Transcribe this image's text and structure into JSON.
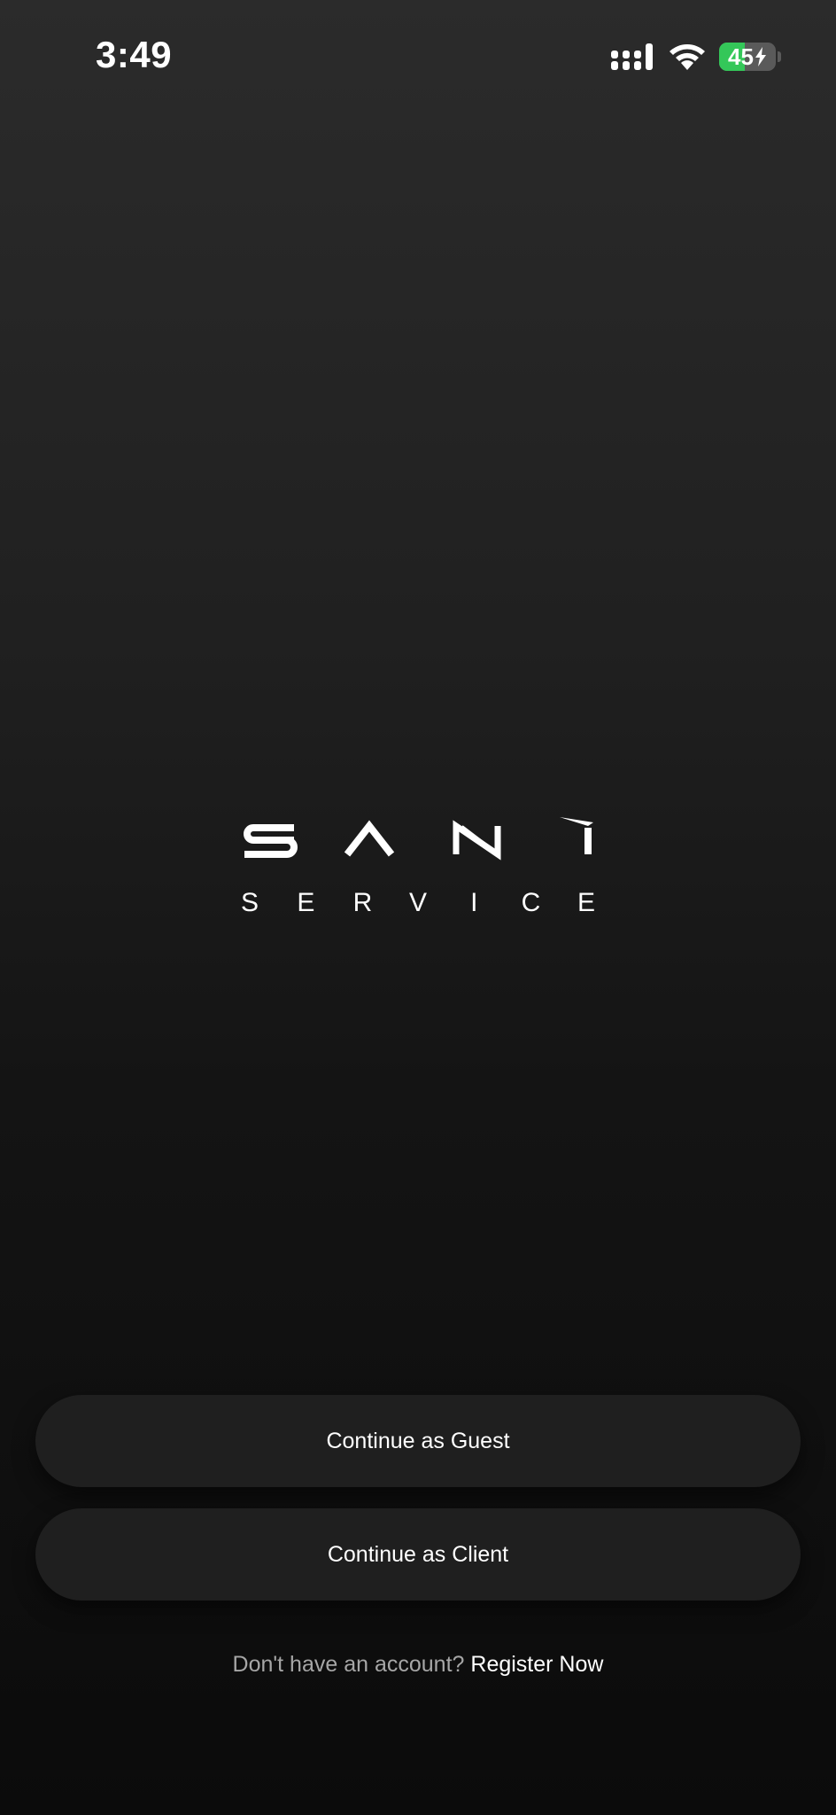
{
  "status_bar": {
    "time": "3:49",
    "battery_percent": "45",
    "battery_level": 0.45,
    "icons": [
      "cellular-signal-icon",
      "wifi-icon",
      "battery-charging-icon"
    ],
    "battery_color": "#34c759"
  },
  "logo": {
    "wordmark": "SANI",
    "subtitle_letters": [
      "S",
      "E",
      "R",
      "V",
      "I",
      "C",
      "E"
    ]
  },
  "actions": {
    "guest_label": "Continue as Guest",
    "client_label": "Continue as Client"
  },
  "register": {
    "prompt": "Don't have an account?",
    "link_label": "Register Now"
  },
  "colors": {
    "background_top": "#2b2b2b",
    "background_bottom": "#0b0b0b",
    "button_background": "#1f1f1f",
    "text_primary": "#ffffff",
    "text_secondary": "#a6a6a6"
  }
}
